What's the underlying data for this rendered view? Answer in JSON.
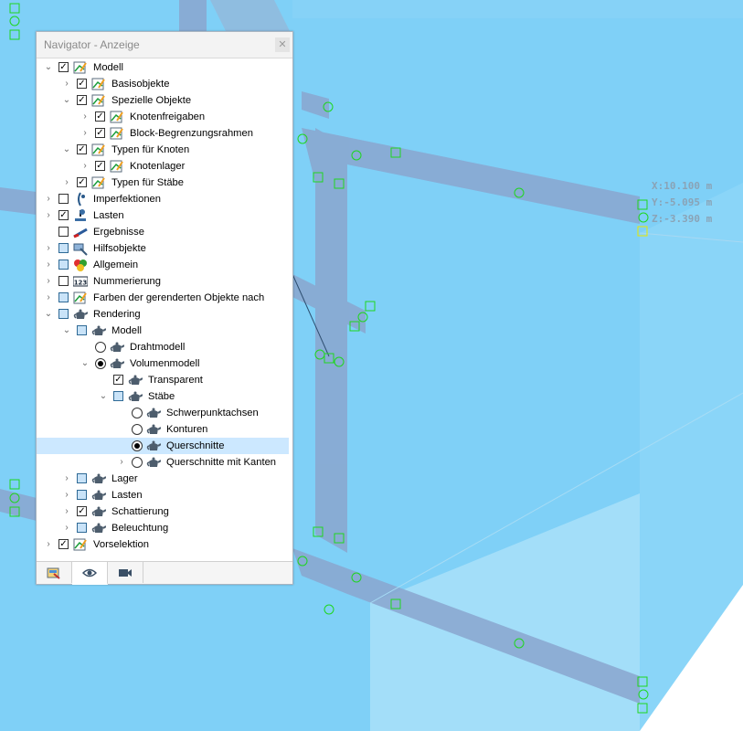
{
  "window": {
    "title": "Navigator - Anzeige",
    "close_icon": "close-icon"
  },
  "coordinates": {
    "x": "X:10.100 m",
    "y": "Y:-5.095 m",
    "z": "Z:-3.390 m"
  },
  "tree": [
    {
      "label": "Modell",
      "level": 0,
      "expander": "open",
      "control": "check",
      "state": "checked",
      "icon": "model-icon"
    },
    {
      "label": "Basisobjekte",
      "level": 1,
      "expander": "closed",
      "control": "check",
      "state": "checked",
      "icon": "model-icon"
    },
    {
      "label": "Spezielle Objekte",
      "level": 1,
      "expander": "open",
      "control": "check",
      "state": "checked",
      "icon": "model-icon"
    },
    {
      "label": "Knotenfreigaben",
      "level": 2,
      "expander": "closed",
      "control": "check",
      "state": "checked",
      "icon": "model-icon"
    },
    {
      "label": "Block-Begrenzungsrahmen",
      "level": 2,
      "expander": "closed",
      "control": "check",
      "state": "checked",
      "icon": "model-icon"
    },
    {
      "label": "Typen für Knoten",
      "level": 1,
      "expander": "open",
      "control": "check",
      "state": "checked",
      "icon": "model-icon"
    },
    {
      "label": "Knotenlager",
      "level": 2,
      "expander": "closed",
      "control": "check",
      "state": "checked",
      "icon": "model-icon"
    },
    {
      "label": "Typen für Stäbe",
      "level": 1,
      "expander": "closed",
      "control": "check",
      "state": "checked",
      "icon": "model-icon"
    },
    {
      "label": "Imperfektionen",
      "level": 0,
      "expander": "closed",
      "control": "check",
      "state": "unchecked",
      "icon": "imperfection-icon"
    },
    {
      "label": "Lasten",
      "level": 0,
      "expander": "closed",
      "control": "check",
      "state": "checked",
      "icon": "load-icon"
    },
    {
      "label": "Ergebnisse",
      "level": 0,
      "expander": "none",
      "control": "check",
      "state": "unchecked",
      "icon": "results-icon"
    },
    {
      "label": "Hilfsobjekte",
      "level": 0,
      "expander": "closed",
      "control": "check",
      "state": "partial",
      "icon": "guide-objects-icon"
    },
    {
      "label": "Allgemein",
      "level": 0,
      "expander": "closed",
      "control": "check",
      "state": "partial",
      "icon": "general-icon"
    },
    {
      "label": "Nummerierung",
      "level": 0,
      "expander": "closed",
      "control": "check",
      "state": "unchecked",
      "icon": "numbering-icon"
    },
    {
      "label": "Farben der gerenderten Objekte nach",
      "level": 0,
      "expander": "closed",
      "control": "check",
      "state": "partial",
      "icon": "model-icon"
    },
    {
      "label": "Rendering",
      "level": 0,
      "expander": "open",
      "control": "check",
      "state": "partial",
      "icon": "teapot-icon"
    },
    {
      "label": "Modell",
      "level": 1,
      "expander": "open",
      "control": "check",
      "state": "partial",
      "icon": "teapot-icon"
    },
    {
      "label": "Drahtmodell",
      "level": 2,
      "expander": "none",
      "control": "radio",
      "state": "off",
      "icon": "teapot-icon"
    },
    {
      "label": "Volumenmodell",
      "level": 2,
      "expander": "open",
      "control": "radio",
      "state": "on",
      "icon": "teapot-icon"
    },
    {
      "label": "Transparent",
      "level": 3,
      "expander": "none",
      "control": "check",
      "state": "checked",
      "icon": "teapot-icon"
    },
    {
      "label": "Stäbe",
      "level": 3,
      "expander": "open",
      "control": "check",
      "state": "partial",
      "icon": "teapot-icon"
    },
    {
      "label": "Schwerpunktachsen",
      "level": 4,
      "expander": "none",
      "control": "radio",
      "state": "off",
      "icon": "teapot-icon"
    },
    {
      "label": "Konturen",
      "level": 4,
      "expander": "none",
      "control": "radio",
      "state": "off",
      "icon": "teapot-icon"
    },
    {
      "label": "Querschnitte",
      "level": 4,
      "expander": "none",
      "control": "radio",
      "state": "on",
      "icon": "teapot-icon",
      "selected": true
    },
    {
      "label": "Querschnitte mit Kanten",
      "level": 4,
      "expander": "closed",
      "control": "radio",
      "state": "off",
      "icon": "teapot-icon"
    },
    {
      "label": "Lager",
      "level": 1,
      "expander": "closed",
      "control": "check",
      "state": "partial",
      "icon": "teapot-icon"
    },
    {
      "label": "Lasten",
      "level": 1,
      "expander": "closed",
      "control": "check",
      "state": "partial",
      "icon": "teapot-icon"
    },
    {
      "label": "Schattierung",
      "level": 1,
      "expander": "closed",
      "control": "check",
      "state": "checked",
      "icon": "teapot-icon"
    },
    {
      "label": "Beleuchtung",
      "level": 1,
      "expander": "closed",
      "control": "check",
      "state": "partial",
      "icon": "teapot-icon"
    },
    {
      "label": "Vorselektion",
      "level": 0,
      "expander": "closed",
      "control": "check",
      "state": "checked",
      "icon": "model-icon"
    }
  ],
  "tabs": [
    {
      "name": "tab-data",
      "icon": "data-icon",
      "active": false
    },
    {
      "name": "tab-display",
      "icon": "eye-icon",
      "active": true
    },
    {
      "name": "tab-views",
      "icon": "camera-icon",
      "active": false
    }
  ]
}
